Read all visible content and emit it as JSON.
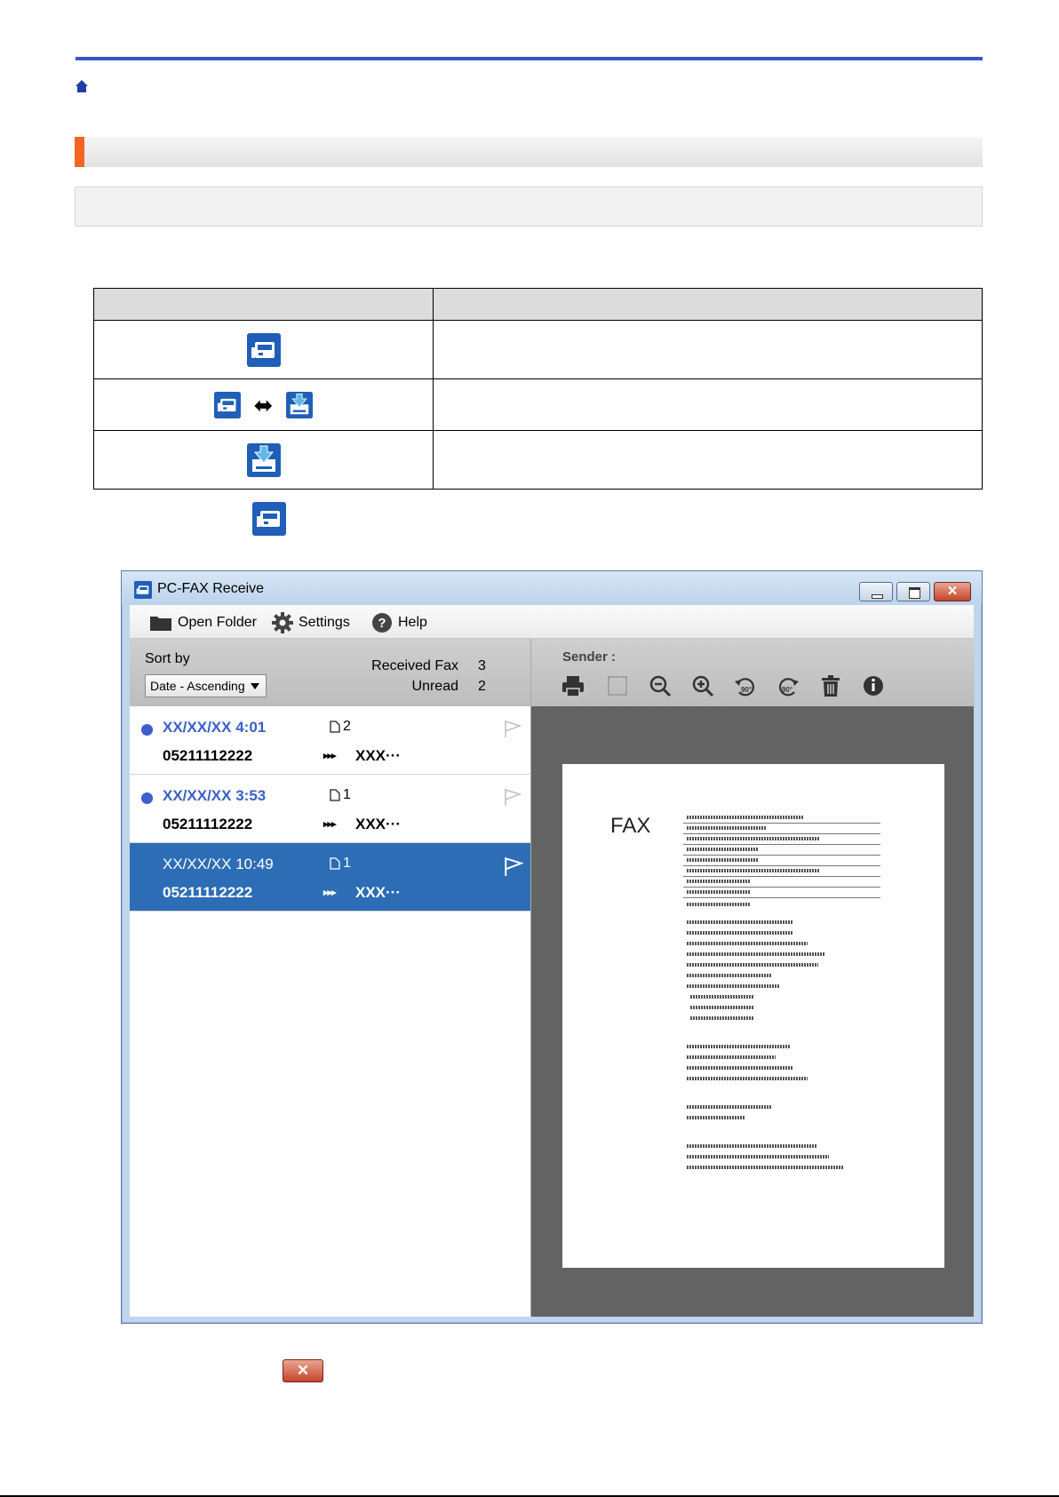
{
  "icons": {
    "home": "home-icon",
    "pcfax_normal": "pc-fax-receive-icon",
    "pcfax_received": "pc-fax-received-icon",
    "arrow": "double-arrow-icon"
  },
  "states_table": {
    "rows": [
      {
        "icon": "pc-fax-receive-icon"
      },
      {
        "icon": "alternating-icons"
      },
      {
        "icon": "pc-fax-received-icon"
      }
    ]
  },
  "window": {
    "title": "PC-FAX Receive",
    "close_symbol": "✕",
    "menu": {
      "open_folder": "Open Folder",
      "settings": "Settings",
      "help": "Help"
    },
    "list": {
      "sort_label": "Sort by",
      "sort_value": "Date - Ascending",
      "received_label": "Received Fax",
      "received_value": "3",
      "unread_label": "Unread",
      "unread_value": "2",
      "items": [
        {
          "date": "XX/XX/XX 4:01",
          "pages": "2",
          "number": "05211112222",
          "arrows": "▸▸▸",
          "sender": "XXX···",
          "unread": true
        },
        {
          "date": "XX/XX/XX 3:53",
          "pages": "1",
          "number": "05211112222",
          "arrows": "▸▸▸",
          "sender": "XXX···",
          "unread": true
        },
        {
          "date": "XX/XX/XX 10:49",
          "pages": "1",
          "number": "05211112222",
          "arrows": "▸▸▸",
          "sender": "XXX···",
          "unread": false
        }
      ]
    },
    "preview": {
      "sender_label": "Sender :",
      "toolbar": [
        "print-icon",
        "fit-icon",
        "zoom-out-icon",
        "zoom-in-icon",
        "rotate-left-90-icon",
        "rotate-right-90-icon",
        "delete-icon",
        "info-icon"
      ],
      "rotate_text": "90°",
      "fax_word": "FAX"
    }
  },
  "close_button_image": {
    "symbol": "✕"
  },
  "colors": {
    "accent_blue": "#3954c8",
    "heading_orange": "#f26522",
    "selection_blue": "#2d6db5",
    "icon_blue": "#1f5fb8"
  }
}
